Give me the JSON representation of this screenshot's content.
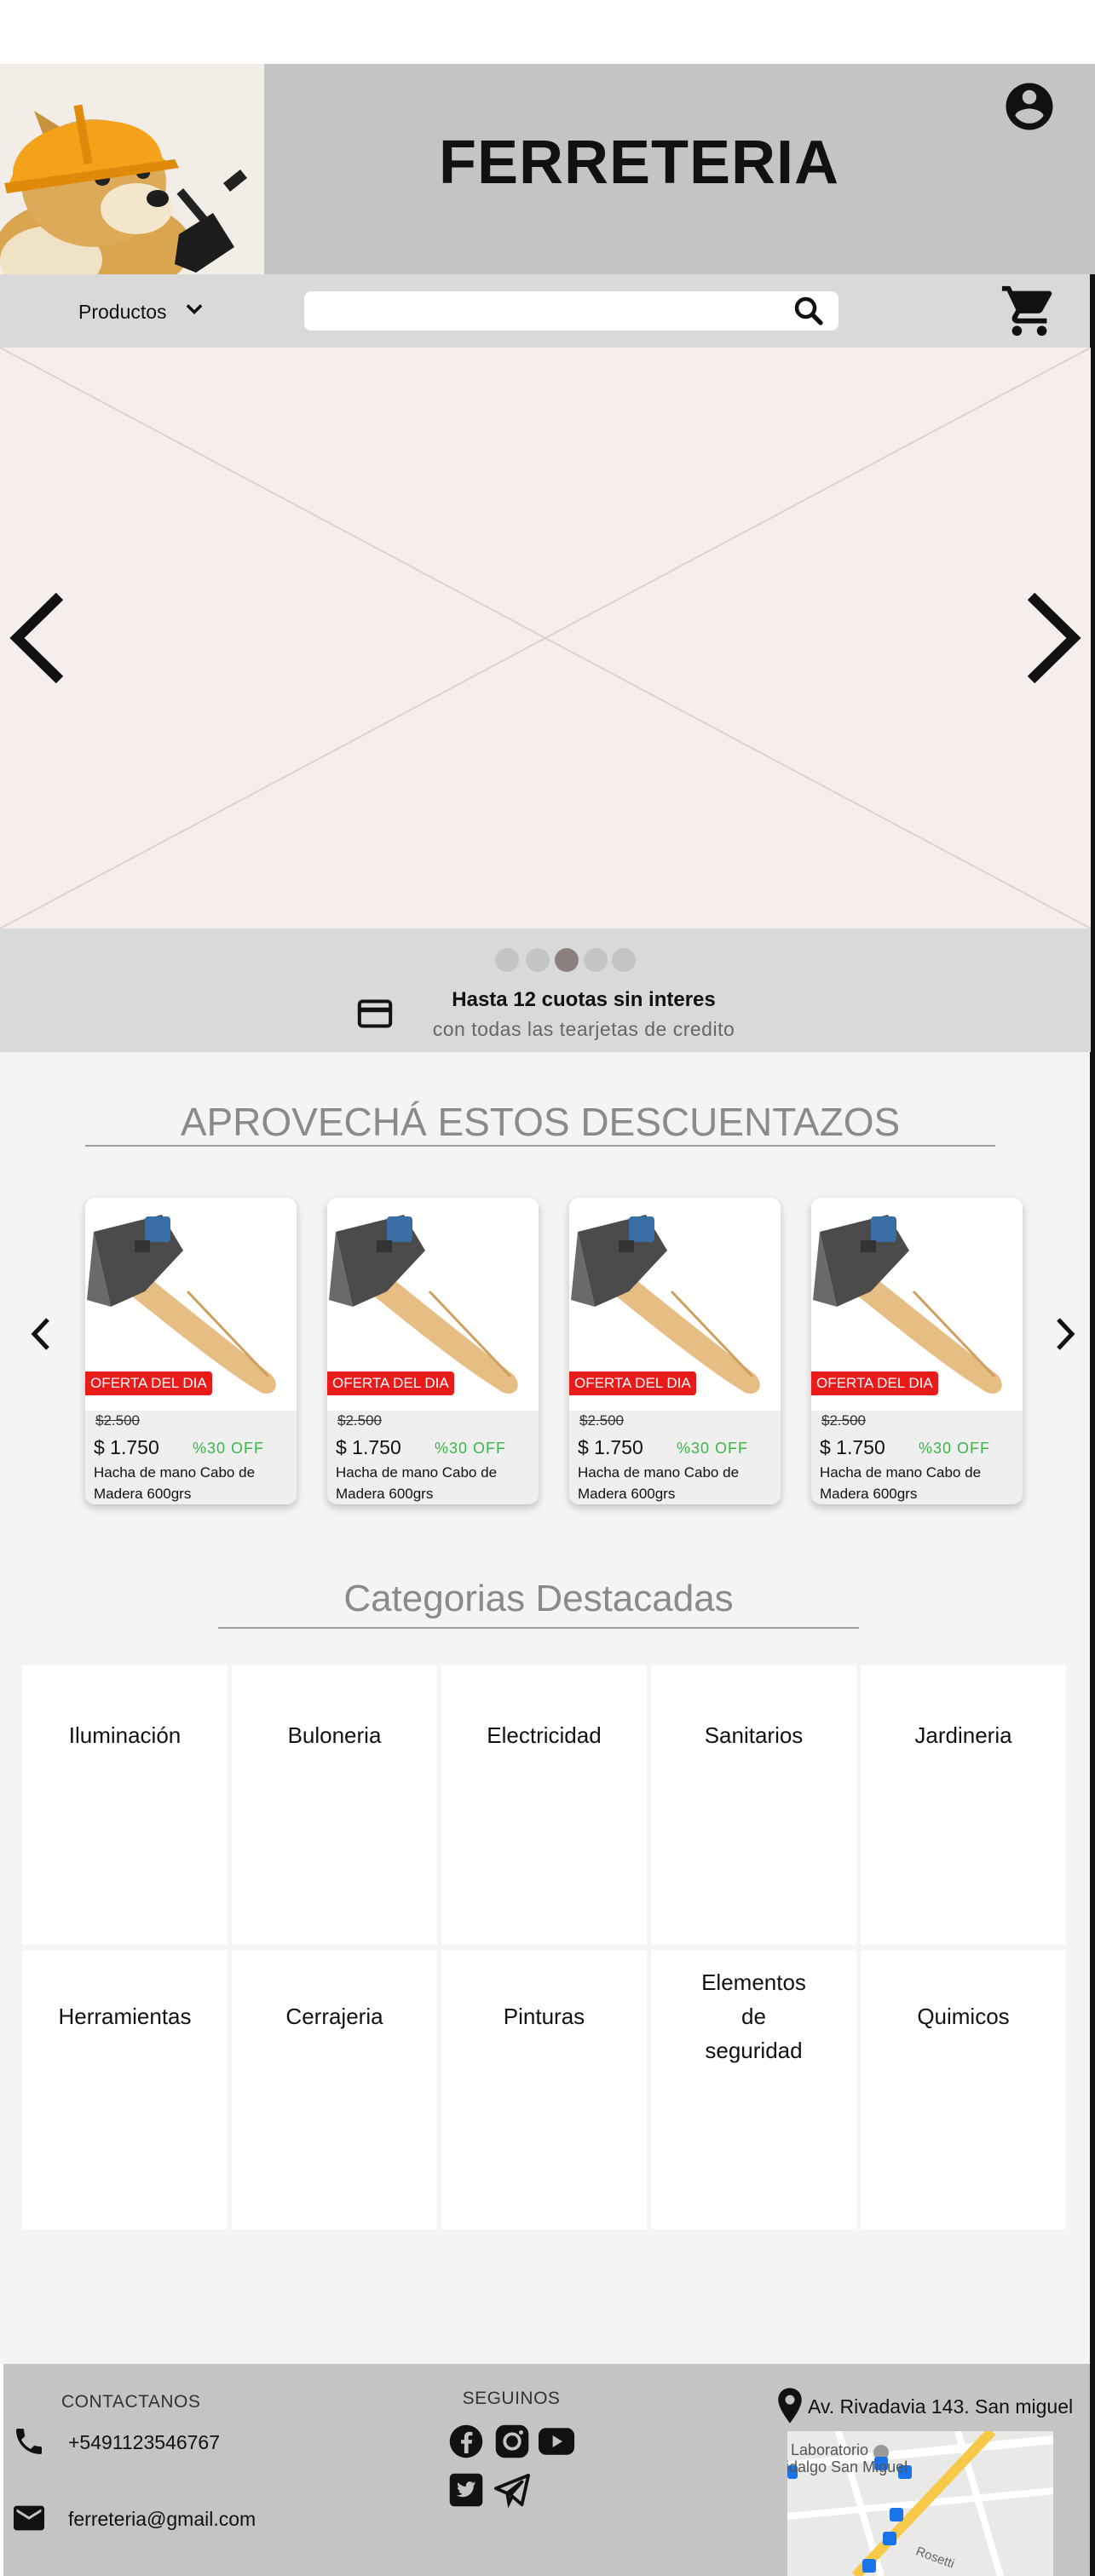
{
  "header": {
    "brand": "FERRETERIA"
  },
  "nav": {
    "products_label": "Productos",
    "search_placeholder": "",
    "search_value": ""
  },
  "carousel": {
    "slide_count": 5,
    "active_index": 2,
    "promo_title": "Hasta 12 cuotas sin interes",
    "promo_subtitle": "con todas las tearjetas de credito"
  },
  "deals": {
    "title": "APROVECHÁ ESTOS DESCUENTAZOS",
    "products": [
      {
        "badge": "OFERTA DEL DIA",
        "old_price": "$2.500",
        "price": "$ 1.750",
        "discount": "%30 OFF",
        "name": "Hacha de mano Cabo de Madera 600grs"
      },
      {
        "badge": "OFERTA DEL DIA",
        "old_price": "$2.500",
        "price": "$ 1.750",
        "discount": "%30 OFF",
        "name": "Hacha de mano Cabo de Madera 600grs"
      },
      {
        "badge": "OFERTA DEL DIA",
        "old_price": "$2.500",
        "price": "$ 1.750",
        "discount": "%30 OFF",
        "name": "Hacha de mano Cabo de Madera 600grs"
      },
      {
        "badge": "OFERTA DEL DIA",
        "old_price": "$2.500",
        "price": "$ 1.750",
        "discount": "%30 OFF",
        "name": "Hacha de mano Cabo de Madera 600grs"
      }
    ]
  },
  "categories": {
    "title": "Categorias Destacadas",
    "items": [
      {
        "label": "Iluminación"
      },
      {
        "label": "Buloneria"
      },
      {
        "label": "Electricidad"
      },
      {
        "label": "Sanitarios"
      },
      {
        "label": "Jardineria"
      },
      {
        "label": "Herramientas"
      },
      {
        "label": "Cerrajeria"
      },
      {
        "label": "Pinturas"
      },
      {
        "label": "Elementos de seguridad",
        "lines": [
          "Elementos",
          "de",
          "seguridad"
        ]
      },
      {
        "label": "Quimicos"
      }
    ]
  },
  "footer": {
    "contact_title": "CONTACTANOS",
    "phone": "+5491123546767",
    "email": "ferreteria@gmail.com",
    "follow_title": "SEGUINOS",
    "social_icons": [
      "facebook-icon",
      "instagram-icon",
      "youtube-icon",
      "twitter-icon",
      "telegram-icon"
    ],
    "address": "Av. Rivadavia 143. San miguel",
    "map_labels": [
      "Laboratorio",
      "idalgo San Miguel",
      "Rosetti"
    ]
  },
  "colors": {
    "header_band": "#c4c4c4",
    "nav_bar": "#d9d9d9",
    "hero_bg": "#f6eded",
    "badge": "#e81a1a",
    "discount": "#3bb54a",
    "section_title": "#8a8a8a"
  }
}
